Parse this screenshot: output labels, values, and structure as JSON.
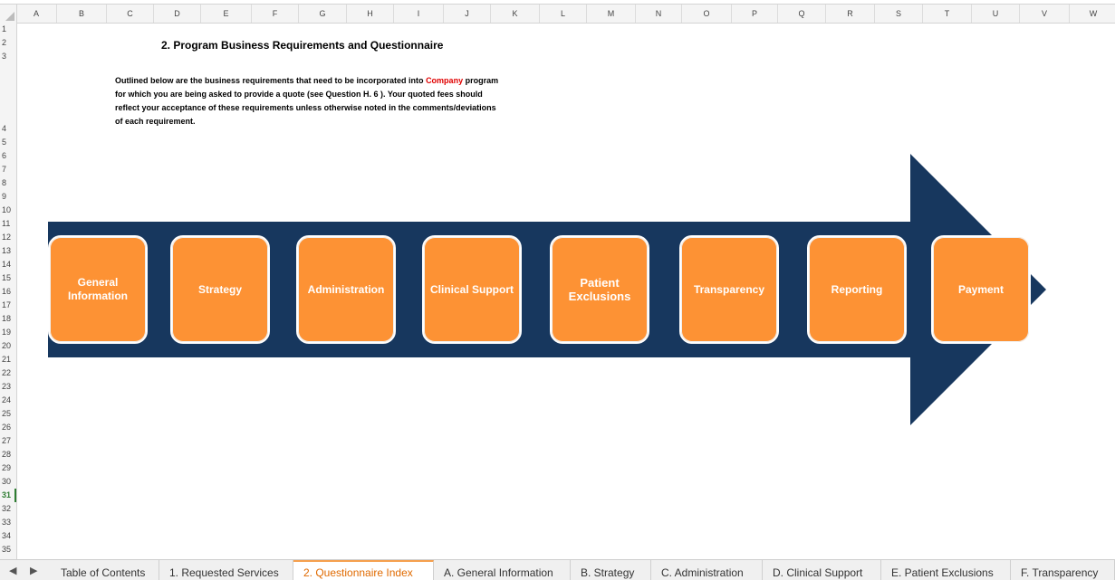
{
  "columns": [
    "A",
    "B",
    "C",
    "D",
    "E",
    "F",
    "G",
    "H",
    "I",
    "J",
    "K",
    "L",
    "M",
    "N",
    "O",
    "P",
    "Q",
    "R",
    "S",
    "T",
    "U",
    "V",
    "W"
  ],
  "rows": [
    "1",
    "2",
    "3",
    "4",
    "5",
    "6",
    "7",
    "8",
    "9",
    "10",
    "11",
    "12",
    "13",
    "14",
    "15",
    "16",
    "17",
    "18",
    "19",
    "20",
    "21",
    "22",
    "23",
    "24",
    "25",
    "26",
    "27",
    "28",
    "29",
    "30",
    "31",
    "32",
    "33",
    "34",
    "35"
  ],
  "selected_row": "31",
  "title": "2.  Program Business Requirements and Questionnaire",
  "description": {
    "part1": "Outlined below are the business requirements that need to be incorporated into ",
    "highlight": "Company",
    "part2": " program for which you are being asked to provide a quote (see Question H. 6 ). Your quoted fees should reflect your acceptance of these requirements unless otherwise noted in the comments/deviations of each requirement."
  },
  "process_steps": [
    {
      "line1": "General",
      "line2": "Information"
    },
    {
      "line1": "Strategy",
      "line2": ""
    },
    {
      "line1": "Administration",
      "line2": ""
    },
    {
      "line1": "Clinical Support",
      "line2": ""
    },
    {
      "line1": "Patient",
      "line2": "Exclusions"
    },
    {
      "line1": "Transparency",
      "line2": ""
    },
    {
      "line1": "Reporting",
      "line2": ""
    },
    {
      "line1": "Payment",
      "line2": ""
    }
  ],
  "colors": {
    "arrow": "#17375e",
    "box": "#fd9234",
    "accent_red": "#e00000",
    "active_tab": "#e06a00"
  },
  "nav": {
    "prev": "◀",
    "next": "▶"
  },
  "tabs": [
    "Table of Contents",
    "1. Requested Services",
    "2. Questionnaire Index",
    "A. General Information",
    "B. Strategy",
    "C. Administration",
    "D. Clinical Support",
    "E. Patient Exclusions",
    "F. Transparency"
  ],
  "active_tab_index": 2
}
